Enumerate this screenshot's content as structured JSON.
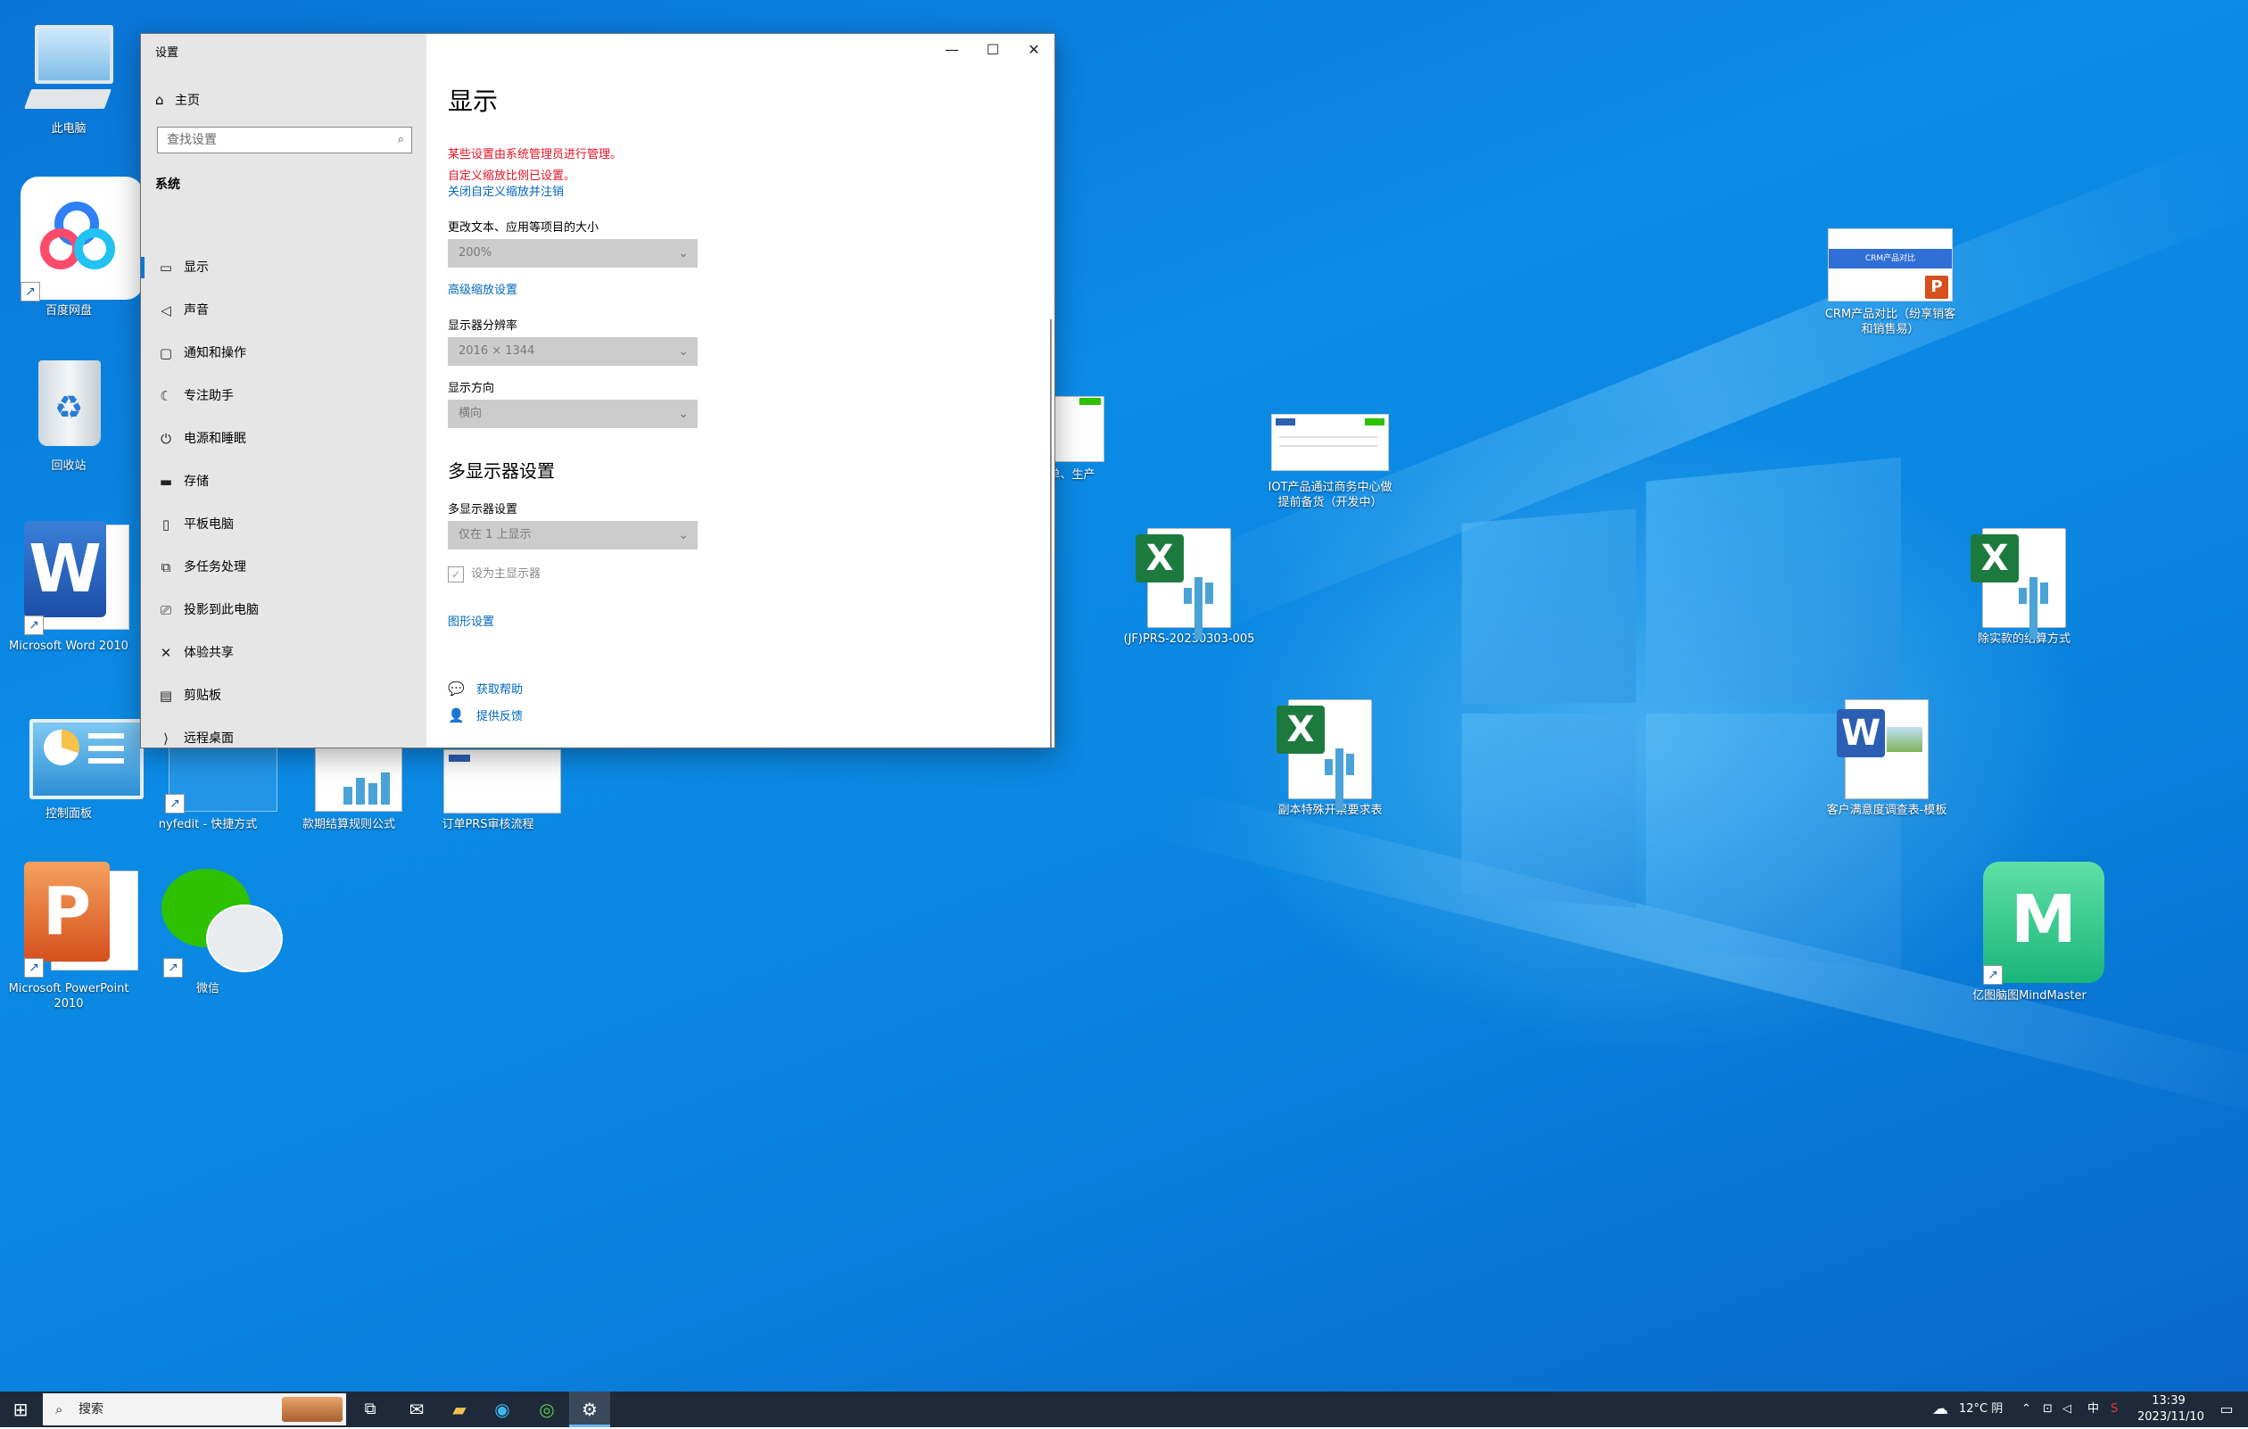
{
  "desktop_icons": [
    {
      "label": "此电脑"
    },
    {
      "label": "百度网盘"
    },
    {
      "label": "回收站"
    },
    {
      "label": "Microsoft Word 2010"
    },
    {
      "label": "控制面板"
    },
    {
      "label": "Microsoft PowerPoint 2010"
    },
    {
      "label": "nyfedit - 快捷方式"
    },
    {
      "label": "款期结算规则公式"
    },
    {
      "label": "订单PRS审核流程"
    },
    {
      "label": "微信"
    },
    {
      "label": "下单、生产"
    },
    {
      "label": "(JF)PRS-20230303-005"
    },
    {
      "label": "IOT产品通过商务中心做提前备货（开发中）"
    },
    {
      "label": "副本特殊开票要求表"
    },
    {
      "label": "CRM产品对比（纷享销客和销售易）",
      "thumb_text": "CRM产品对比"
    },
    {
      "label": "除实款的结算方式"
    },
    {
      "label": "客户满意度调查表-模板"
    },
    {
      "label": "亿图脑图MindMaster"
    }
  ],
  "window": {
    "title": "设置",
    "nav": {
      "home": "主页",
      "search_placeholder": "查找设置",
      "section": "系统",
      "items": [
        {
          "label": "显示",
          "icon": "monitor-icon",
          "selected": true
        },
        {
          "label": "声音",
          "icon": "speaker-icon",
          "selected": false
        },
        {
          "label": "通知和操作",
          "icon": "notification-icon",
          "selected": false
        },
        {
          "label": "专注助手",
          "icon": "moon-icon",
          "selected": false
        },
        {
          "label": "电源和睡眠",
          "icon": "power-icon",
          "selected": false
        },
        {
          "label": "存储",
          "icon": "storage-icon",
          "selected": false
        },
        {
          "label": "平板电脑",
          "icon": "tablet-icon",
          "selected": false
        },
        {
          "label": "多任务处理",
          "icon": "multitask-icon",
          "selected": false
        },
        {
          "label": "投影到此电脑",
          "icon": "project-icon",
          "selected": false
        },
        {
          "label": "体验共享",
          "icon": "share-icon",
          "selected": false
        },
        {
          "label": "剪贴板",
          "icon": "clipboard-icon",
          "selected": false
        },
        {
          "label": "远程桌面",
          "icon": "remote-icon",
          "selected": false
        }
      ]
    },
    "content": {
      "title": "显示",
      "warning1": "某些设置由系统管理员进行管理。",
      "warning2": "自定义缩放比例已设置。",
      "signout_link": "关闭自定义缩放并注销",
      "scale_label": "更改文本、应用等项目的大小",
      "scale_value": "200%",
      "advanced_scaling_link": "高级缩放设置",
      "resolution_label": "显示器分辨率",
      "resolution_value": "2016 × 1344",
      "orientation_label": "显示方向",
      "orientation_value": "横向",
      "multi_header": "多显示器设置",
      "multi_label": "多显示器设置",
      "multi_value": "仅在 1 上显示",
      "main_display_checkbox": "设为主显示器",
      "main_display_checked": true,
      "graphics_link": "图形设置",
      "get_help": "获取帮助",
      "feedback": "提供反馈"
    }
  },
  "taskbar": {
    "search_placeholder": "搜索",
    "weather": "12°C 阴",
    "ime": "中",
    "time": "13:39",
    "date": "2023/11/10"
  }
}
